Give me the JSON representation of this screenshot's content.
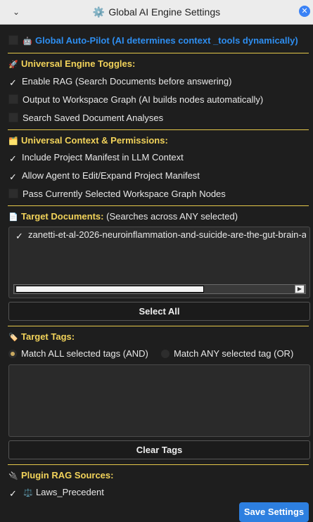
{
  "window": {
    "title": "Global AI Engine Settings",
    "title_icon": "⚙️",
    "collapse_icon": "⌄",
    "close_icon": "✕"
  },
  "autopilot": {
    "icon": "🤖",
    "label": "Global Auto-Pilot (AI determines context _tools dynamically)",
    "checked": false
  },
  "engine_toggles": {
    "icon": "🚀",
    "header": "Universal Engine Toggles:",
    "items": [
      {
        "label": "Enable RAG (Search Documents before answering)",
        "checked": true
      },
      {
        "label": "Output to Workspace Graph (AI builds nodes automatically)",
        "checked": false
      },
      {
        "label": "Search Saved Document Analyses",
        "checked": false
      }
    ]
  },
  "context_permissions": {
    "icon": "🗂️",
    "header": "Universal Context & Permissions:",
    "items": [
      {
        "label": "Include Project Manifest in LLM Context",
        "checked": true
      },
      {
        "label": "Allow Agent to Edit/Expand Project Manifest",
        "checked": true
      },
      {
        "label": "Pass Currently Selected Workspace Graph Nodes",
        "checked": false
      }
    ]
  },
  "target_documents": {
    "icon": "📄",
    "header": "Target Documents:",
    "subheader": "(Searches across ANY selected)",
    "items": [
      {
        "label": "zanetti-et-al-2026-neuroinflammation-and-suicide-are-the-gut-brain-a",
        "checked": true
      }
    ],
    "select_all_label": "Select All"
  },
  "target_tags": {
    "icon": "🏷️",
    "header": "Target Tags:",
    "match_all_label": "Match ALL selected tags (AND)",
    "match_any_label": "Match ANY selected tag (OR)",
    "selected_mode": "all",
    "clear_label": "Clear Tags"
  },
  "plugin_sources": {
    "icon": "🔌",
    "header": "Plugin RAG Sources:",
    "items": [
      {
        "icon": "⚖️",
        "label": "Laws_Precedent",
        "checked": true
      }
    ]
  },
  "save_label": "Save Settings",
  "check_glyph": "✓"
}
